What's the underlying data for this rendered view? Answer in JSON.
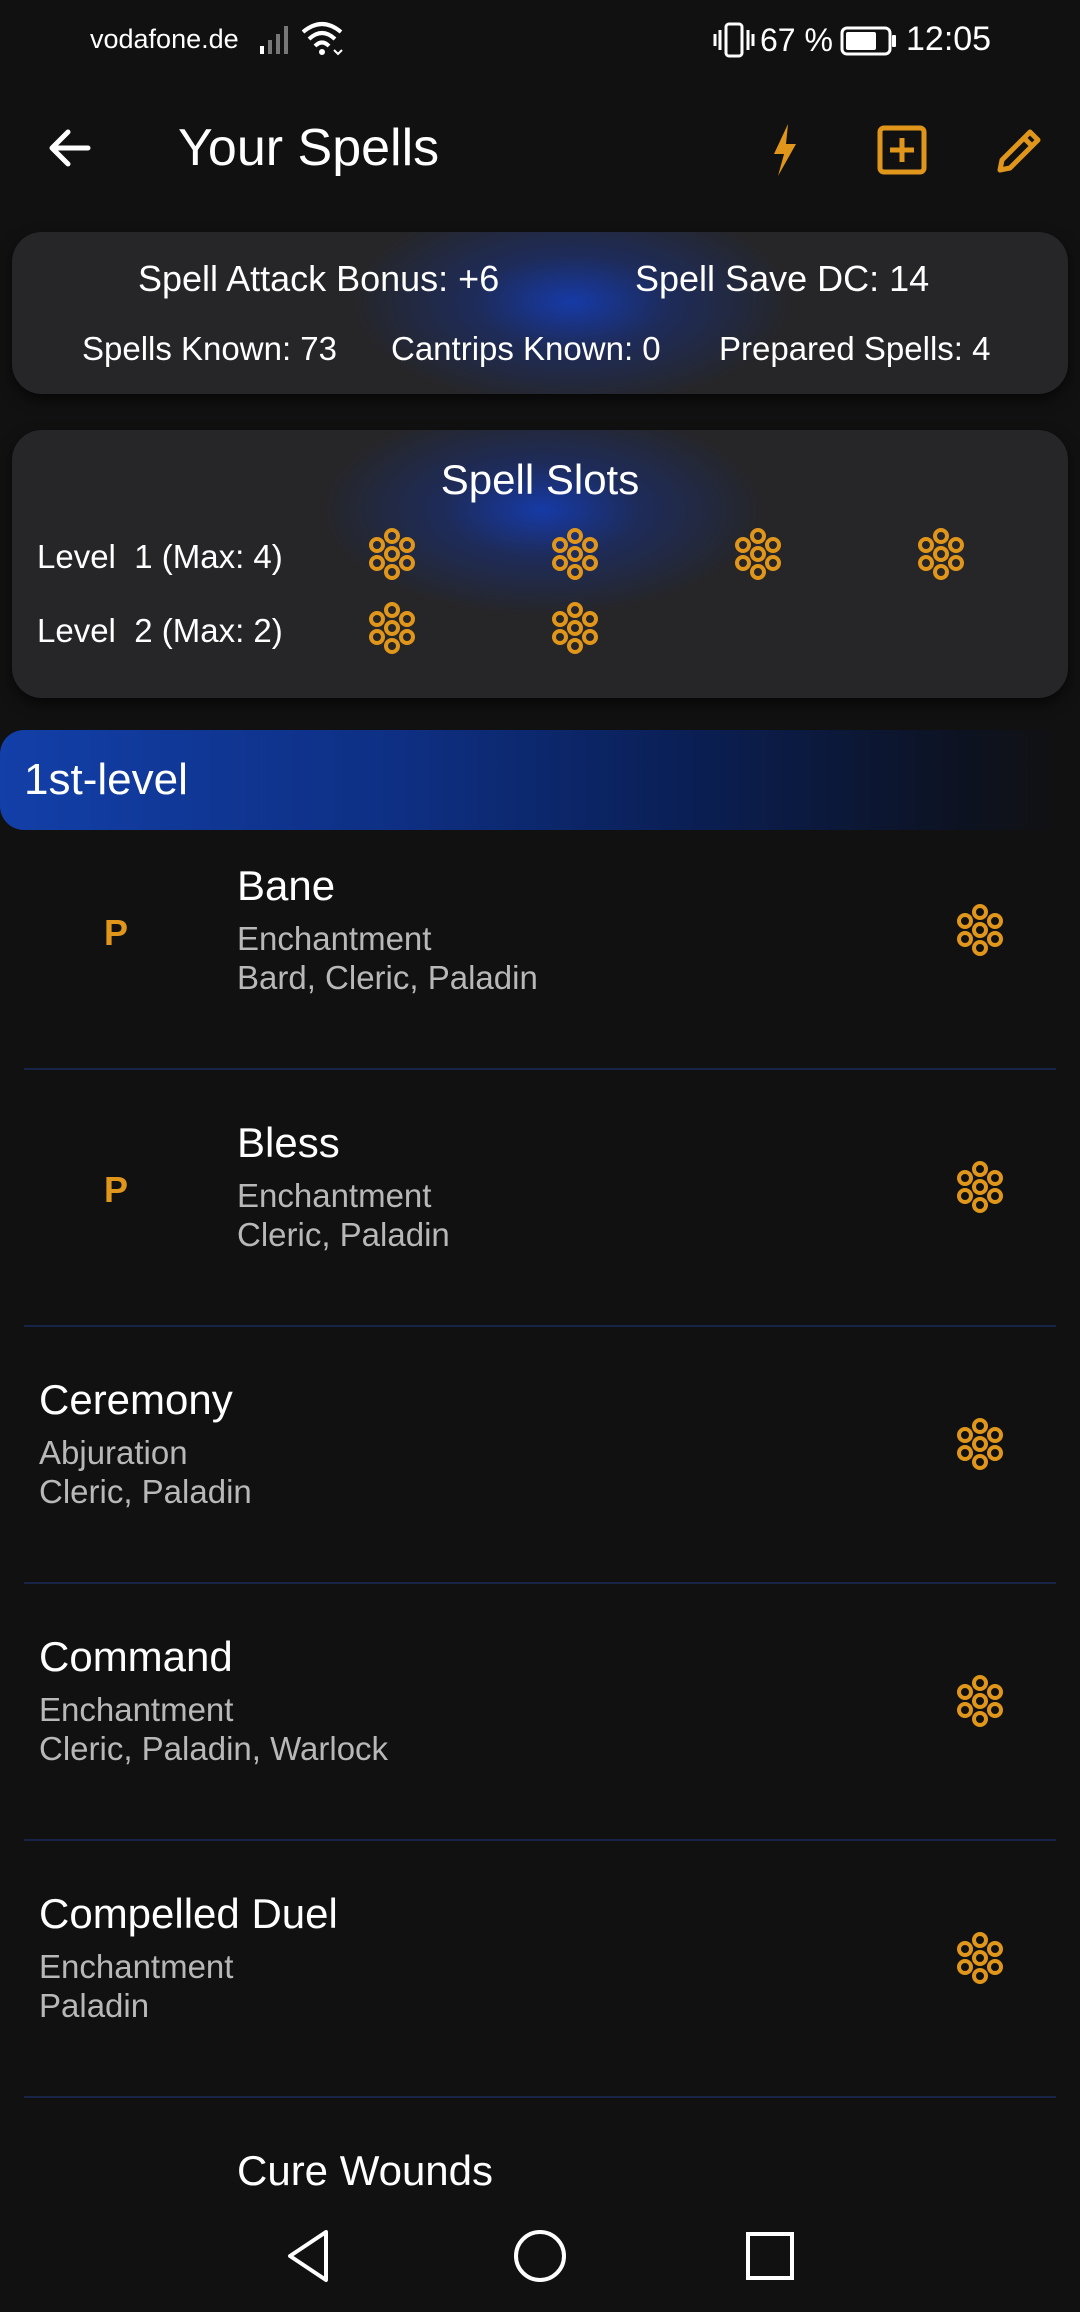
{
  "status_bar": {
    "carrier": "vodafone.de",
    "battery": "67 %",
    "time": "12:05",
    "icons": [
      "signal-icon",
      "wifi-icon",
      "vibrate-icon",
      "battery-icon"
    ]
  },
  "app_bar": {
    "title": "Your Spells",
    "icons": [
      "back-arrow-icon",
      "lightning-icon",
      "add-box-icon",
      "edit-pencil-icon"
    ]
  },
  "stats": {
    "attack_bonus": "Spell Attack Bonus: +6",
    "save_dc": "Spell Save DC: 14",
    "known": "Spells Known: 73",
    "cantrips": "Cantrips Known: 0",
    "prepared": "Prepared Spells: 4"
  },
  "spell_slots": {
    "title": "Spell Slots",
    "levels": [
      {
        "label": "Level  1 (Max: 4)",
        "slots": 4
      },
      {
        "label": "Level  2 (Max: 2)",
        "slots": 2
      }
    ]
  },
  "section": {
    "label": "1st-level"
  },
  "spells": [
    {
      "name": "Bane",
      "school": "Enchantment",
      "classes": "Bard, Cleric, Paladin",
      "prepared": "P"
    },
    {
      "name": "Bless",
      "school": "Enchantment",
      "classes": "Cleric, Paladin",
      "prepared": "P"
    },
    {
      "name": "Ceremony",
      "school": "Abjuration",
      "classes": "Cleric, Paladin",
      "prepared": ""
    },
    {
      "name": "Command",
      "school": "Enchantment",
      "classes": "Cleric, Paladin, Warlock",
      "prepared": ""
    },
    {
      "name": "Compelled Duel",
      "school": "Enchantment",
      "classes": "Paladin",
      "prepared": ""
    },
    {
      "name": "Cure Wounds",
      "school": "",
      "classes": "",
      "prepared": ""
    }
  ],
  "colors": {
    "accent": "#e0961a",
    "background": "#111112",
    "card": "#262628",
    "section_blue": "#123fa8"
  }
}
